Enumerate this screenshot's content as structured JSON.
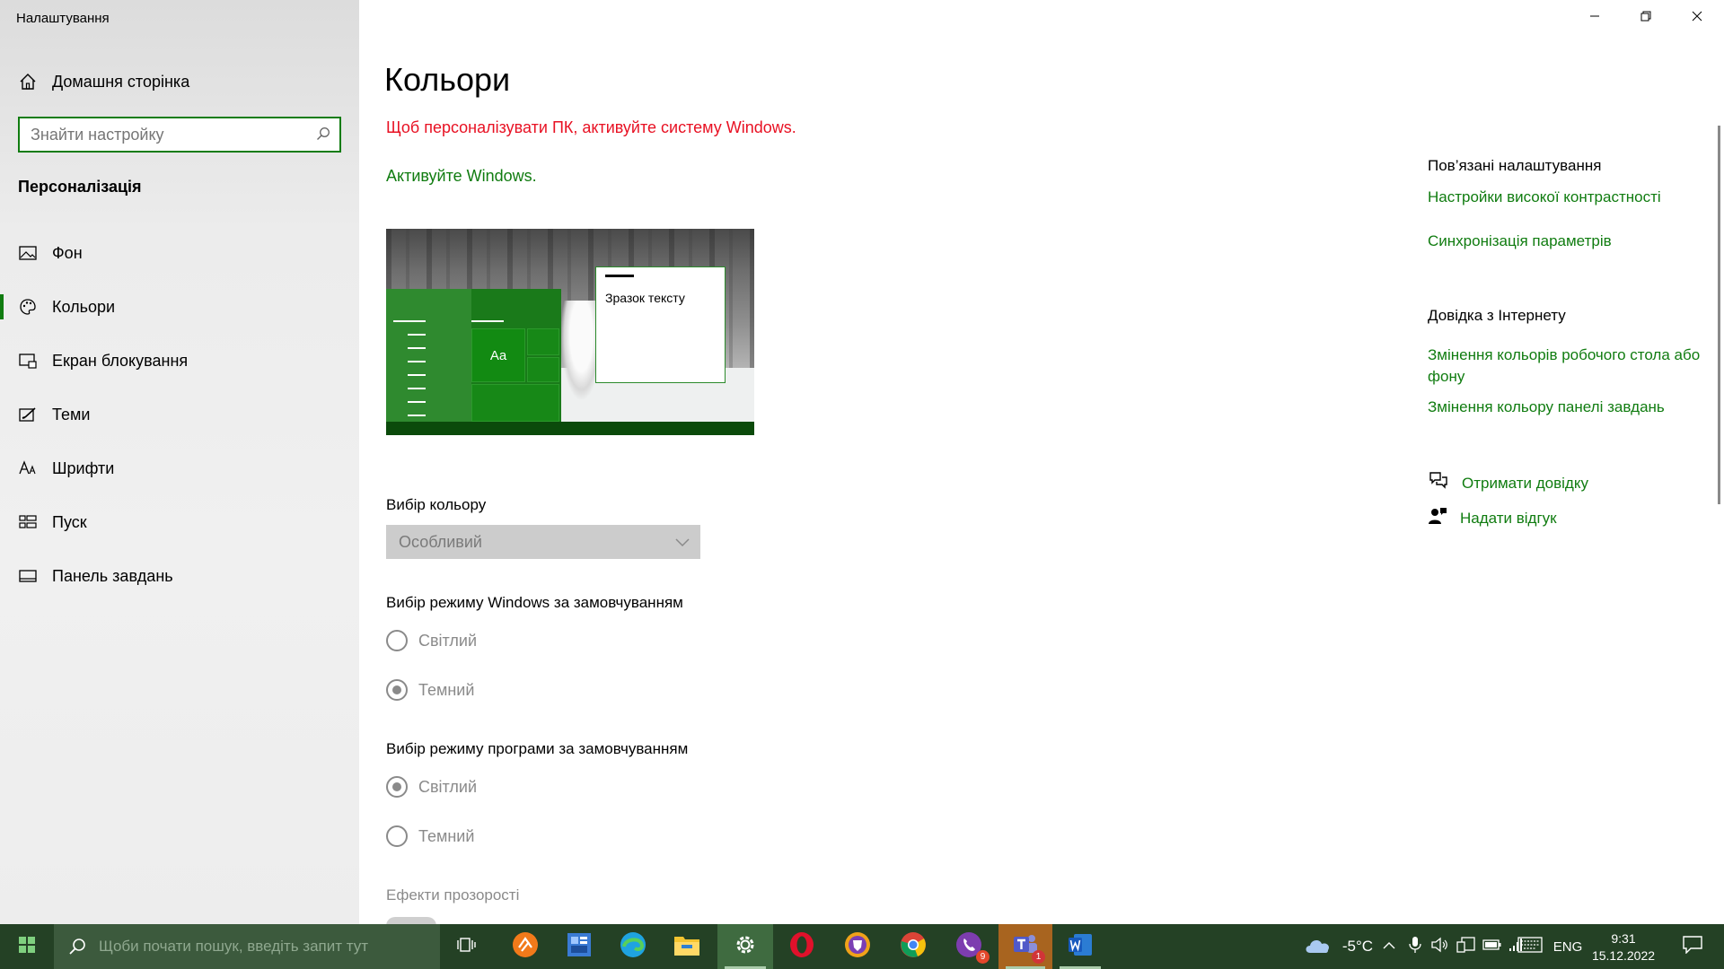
{
  "app": {
    "title": "Налаштування"
  },
  "sidebar": {
    "home_label": "Домашня сторінка",
    "search_placeholder": "Знайти настройку",
    "section_title": "Персоналізація",
    "items": [
      {
        "label": "Фон",
        "icon": "picture-icon"
      },
      {
        "label": "Кольори",
        "icon": "palette-icon",
        "active": true
      },
      {
        "label": "Екран блокування",
        "icon": "lock-screen-icon"
      },
      {
        "label": "Теми",
        "icon": "brush-icon"
      },
      {
        "label": "Шрифти",
        "icon": "font-icon"
      },
      {
        "label": "Пуск",
        "icon": "start-icon"
      },
      {
        "label": "Панель завдань",
        "icon": "taskbar-icon"
      }
    ]
  },
  "main": {
    "title": "Кольори",
    "activation_warning": "Щоб персоналізувати ПК, активуйте систему Windows.",
    "activate_link": "Активуйте Windows.",
    "preview": {
      "sample_text": "Зразок тексту",
      "tile_text": "Aa"
    },
    "color_choice": {
      "label": "Вибір кольору",
      "value": "Особливий"
    },
    "windows_mode": {
      "label": "Вибір режиму Windows за замовчуванням",
      "options": [
        {
          "label": "Світлий",
          "selected": false
        },
        {
          "label": "Темний",
          "selected": true
        }
      ]
    },
    "app_mode": {
      "label": "Вибір режиму програми за замовчуванням",
      "options": [
        {
          "label": "Світлий",
          "selected": true
        },
        {
          "label": "Темний",
          "selected": false
        }
      ]
    },
    "transparency_label": "Ефекти прозорості"
  },
  "related": {
    "heading": "Пов’язані налаштування",
    "links": [
      "Настройки високої контрастності",
      "Синхронізація параметрів"
    ],
    "web_help_heading": "Довідка з Інтернету",
    "web_links": [
      "Змінення кольорів робочого стола або фону",
      "Змінення кольору панелі завдань"
    ],
    "get_help": "Отримати довідку",
    "feedback": "Надати відгук"
  },
  "taskbar": {
    "search_placeholder": "Щоби почати пошук, введіть запит тут",
    "apps": [
      {
        "name": "task-view-icon"
      },
      {
        "name": "sublime-icon"
      },
      {
        "name": "calculator-app-icon"
      },
      {
        "name": "edge-icon"
      },
      {
        "name": "file-explorer-icon"
      },
      {
        "name": "settings-icon",
        "active": true
      },
      {
        "name": "opera-icon"
      },
      {
        "name": "brave-icon"
      },
      {
        "name": "chrome-icon"
      },
      {
        "name": "viber-icon",
        "badge": "9"
      },
      {
        "name": "teams-icon",
        "badge": "1"
      },
      {
        "name": "word-icon"
      }
    ],
    "weather": "-5°C",
    "language": "ENG",
    "time": "9:31",
    "date": "15.12.2022"
  },
  "colors": {
    "accent": "#107c10",
    "warning": "#e81123",
    "taskbar": "#244125"
  }
}
